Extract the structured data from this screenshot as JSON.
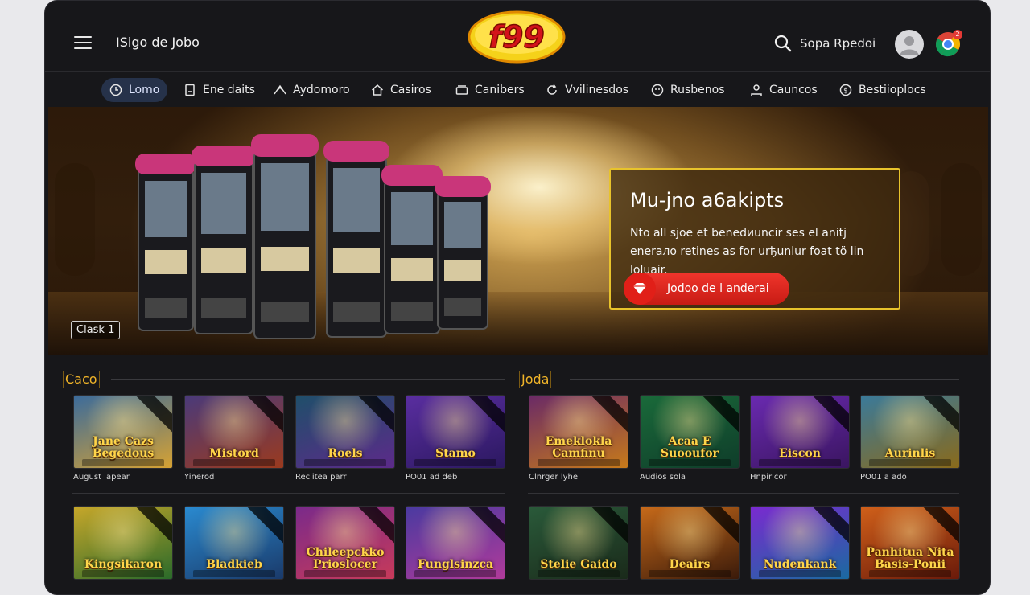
{
  "header": {
    "site_title": "ISigo de Jobo",
    "logo_text": "f99",
    "search_label": "Sopa Rpedoi",
    "notification_count": "2"
  },
  "nav": {
    "items": [
      {
        "label": "Lomo",
        "icon": "clock-icon",
        "active": true
      },
      {
        "label": "Ene daits",
        "icon": "document-icon"
      },
      {
        "label": "Aydomoro",
        "icon": "tent-icon"
      },
      {
        "label": "Casiros",
        "icon": "home-icon"
      },
      {
        "label": "Canibers",
        "icon": "cards-icon"
      },
      {
        "label": "Vvilinesdos",
        "icon": "refresh-icon"
      },
      {
        "label": "Rusbenos",
        "icon": "dice-icon"
      },
      {
        "label": "Cauncos",
        "icon": "user-icon"
      },
      {
        "label": "Bestiioplocs",
        "icon": "coin-icon"
      }
    ]
  },
  "hero": {
    "badge": "Clask 1",
    "promo_title": "Mu-jno a6akipts",
    "promo_text": "Nto all sjoe et benedиuncir ses el anitj enerалo retines as for urђunlur foat tö lin loluair.",
    "promo_button": "Jodoo de l anderai"
  },
  "sections": [
    {
      "title": "Caco"
    },
    {
      "title": "Joda"
    }
  ],
  "games_row1": [
    {
      "name": "Jane Cazs Begedous",
      "caption": "August lapear",
      "colors": [
        "#3b6b9b",
        "#d6a233"
      ]
    },
    {
      "name": "Mistord",
      "caption": "Yinerod",
      "colors": [
        "#4a3a7a",
        "#9b3a1e"
      ]
    },
    {
      "name": "Roels",
      "caption": "Reclitea parr",
      "colors": [
        "#1f4f6a",
        "#5c2a8a"
      ]
    },
    {
      "name": "Stamo",
      "caption": "PO01 ad deb",
      "colors": [
        "#5a2ea0",
        "#2b1860"
      ]
    },
    {
      "name": "Emeklokla Camfinu",
      "caption": "Clnrger lyhe",
      "colors": [
        "#6a2a66",
        "#c77a1a"
      ]
    },
    {
      "name": "Acaa E Suooufor",
      "caption": "Audios sola",
      "colors": [
        "#1a6a3a",
        "#0f3d2a"
      ]
    },
    {
      "name": "Eiscon",
      "caption": "Hnpiricor",
      "colors": [
        "#6a2ab0",
        "#3a1560"
      ]
    },
    {
      "name": "Aurinlis",
      "caption": "PO01 a ado",
      "colors": [
        "#3a7a9a",
        "#8a6a1a"
      ]
    }
  ],
  "games_row2": [
    {
      "name": "Kingsikaron",
      "colors": [
        "#c7a72a",
        "#2a6a2a"
      ]
    },
    {
      "name": "Bladkieb",
      "colors": [
        "#2a8ad0",
        "#1a3a6a"
      ]
    },
    {
      "name": "Chileepckko Prioslocer",
      "colors": [
        "#7a2a8a",
        "#c73a5a"
      ]
    },
    {
      "name": "Funglsinzca",
      "colors": [
        "#4a3aa0",
        "#b03a9a"
      ]
    },
    {
      "name": "Stelie Gaido",
      "colors": [
        "#2a5a3a",
        "#1a2a1a"
      ]
    },
    {
      "name": "Deairs",
      "colors": [
        "#c76a1a",
        "#3a1a0a"
      ]
    },
    {
      "name": "Nudenkank",
      "colors": [
        "#7a2ad0",
        "#1a6aa0"
      ]
    },
    {
      "name": "Panhitua Nita Basis-Ponii",
      "colors": [
        "#d0601a",
        "#6a1a0a"
      ]
    }
  ]
}
